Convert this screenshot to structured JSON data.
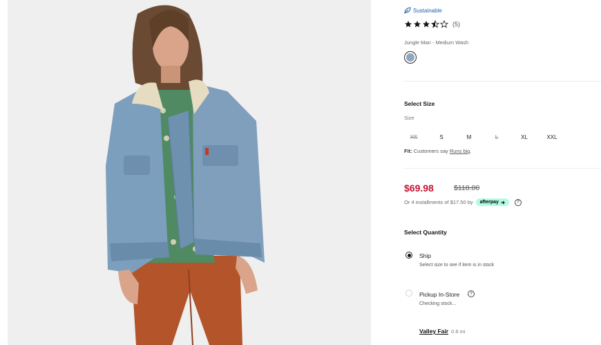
{
  "image": {
    "alt": "",
    "subject": "model-denim-jacket"
  },
  "badge": {
    "label": "Sustainable",
    "icon": "leaf-icon"
  },
  "rating": {
    "stars": 3.5,
    "max": 5,
    "count": "(5)"
  },
  "color": {
    "name": "Jungle Man - Medium Wash",
    "swatch_hex": "#8fa7bd"
  },
  "size": {
    "title": "Select Size",
    "label": "Size",
    "options": [
      {
        "label": "XS",
        "available": false
      },
      {
        "label": "S",
        "available": true
      },
      {
        "label": "M",
        "available": true
      },
      {
        "label": "L",
        "available": false
      },
      {
        "label": "XL",
        "available": true
      },
      {
        "label": "XXL",
        "available": true
      }
    ],
    "fit_prefix": "Fit:",
    "fit_text": "Customers say",
    "fit_link": "Runs big",
    "fit_suffix": "."
  },
  "price": {
    "sale": "$69.98",
    "original": "$118.00",
    "installments": "Or 4 installments of $17.50 by",
    "afterpay": "afterpay",
    "help": "?"
  },
  "quantity": {
    "title": "Select Quantity",
    "ship": {
      "label": "Ship",
      "sub": "Select size to see if item is in stock",
      "selected": true
    },
    "pickup": {
      "label": "Pickup In-Store",
      "sub": "Checking stock...",
      "selected": false
    },
    "store": {
      "name": "Valley Fair",
      "distance": "0.6 mi"
    }
  },
  "colors": {
    "sale": "#c41230",
    "link_blue": "#1f5fb0",
    "afterpay": "#b2fce4"
  }
}
